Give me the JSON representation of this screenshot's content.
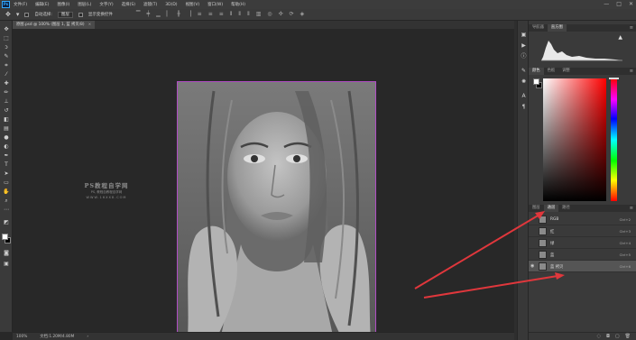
{
  "app": {
    "logo": "Ps"
  },
  "menu": {
    "items": [
      "文件(F)",
      "编辑(E)",
      "图像(I)",
      "图层(L)",
      "文字(Y)",
      "选择(S)",
      "滤镜(T)",
      "3D(D)",
      "视图(V)",
      "窗口(W)",
      "帮助(H)"
    ]
  },
  "window_controls": {
    "minimize": "—",
    "maximize": "□",
    "close": "✕"
  },
  "options_bar": {
    "auto_select_label": "自动选择:",
    "auto_select_value": "图层",
    "show_transform_label": "显示变换控件"
  },
  "document": {
    "tab_title": "原图.psd @ 100% (图层 1, 蓝 拷贝/8)",
    "close": "×"
  },
  "watermark": {
    "title": "PS教程自学网",
    "subtitle": "PS, 教程自教程自学网",
    "url": "WWW.16XX8.COM"
  },
  "status_bar": {
    "zoom": "100%",
    "doc_info": "文档:1.20M/4.80M"
  },
  "panels": {
    "top_tabs": [
      "导航器",
      "直方图"
    ],
    "top_active": 1,
    "color_tabs": [
      "颜色",
      "色板",
      "调整"
    ],
    "color_active": 0,
    "channel_tabs": [
      "图层",
      "通道",
      "路径"
    ],
    "channel_active": 1,
    "channels": [
      {
        "name": "RGB",
        "shortcut": "Ctrl+2",
        "visible": false,
        "selected": false
      },
      {
        "name": "红",
        "shortcut": "Ctrl+3",
        "visible": false,
        "selected": false
      },
      {
        "name": "绿",
        "shortcut": "Ctrl+4",
        "visible": false,
        "selected": false
      },
      {
        "name": "蓝",
        "shortcut": "Ctrl+5",
        "visible": false,
        "selected": false
      },
      {
        "name": "蓝 拷贝",
        "shortcut": "Ctrl+6",
        "visible": true,
        "selected": true
      }
    ]
  },
  "colors": {
    "accent_arrow": "#e0373c",
    "document_border": "#b04cc4",
    "foreground": "#ffffff",
    "background": "#000000"
  }
}
